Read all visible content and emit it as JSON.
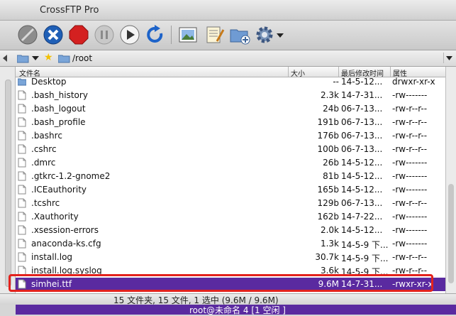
{
  "window": {
    "title": "CrossFTP Pro"
  },
  "toolbar": {
    "icons": [
      "disconnect-icon",
      "connect-x-icon",
      "stop-icon",
      "pause-icon",
      "play-icon",
      "refresh-icon",
      "image-view-icon",
      "notes-edit-icon",
      "new-folder-icon",
      "gear-icon"
    ]
  },
  "pathbar": {
    "path": "/root"
  },
  "columns": {
    "name": "文件名",
    "size": "大小",
    "modified": "最后修改时间",
    "attributes": "属性"
  },
  "files": [
    {
      "name": "Desktop",
      "size": "--",
      "modified": "14-5-12...",
      "perm": "drwxr-xr-x",
      "type": "folder"
    },
    {
      "name": ".bash_history",
      "size": "2.3k",
      "modified": "14-7-31...",
      "perm": "-rw-------",
      "type": "file"
    },
    {
      "name": ".bash_logout",
      "size": "24b",
      "modified": "06-7-13...",
      "perm": "-rw-r--r--",
      "type": "file"
    },
    {
      "name": ".bash_profile",
      "size": "191b",
      "modified": "06-7-13...",
      "perm": "-rw-r--r--",
      "type": "file"
    },
    {
      "name": ".bashrc",
      "size": "176b",
      "modified": "06-7-13...",
      "perm": "-rw-r--r--",
      "type": "file"
    },
    {
      "name": ".cshrc",
      "size": "100b",
      "modified": "06-7-13...",
      "perm": "-rw-r--r--",
      "type": "file"
    },
    {
      "name": ".dmrc",
      "size": "26b",
      "modified": "14-5-12...",
      "perm": "-rw-------",
      "type": "file"
    },
    {
      "name": ".gtkrc-1.2-gnome2",
      "size": "81b",
      "modified": "14-5-12...",
      "perm": "-rw-------",
      "type": "file"
    },
    {
      "name": ".ICEauthority",
      "size": "165b",
      "modified": "14-5-12...",
      "perm": "-rw-------",
      "type": "file"
    },
    {
      "name": ".tcshrc",
      "size": "129b",
      "modified": "06-7-13...",
      "perm": "-rw-r--r--",
      "type": "file"
    },
    {
      "name": ".Xauthority",
      "size": "162b",
      "modified": "14-7-22...",
      "perm": "-rw-------",
      "type": "file"
    },
    {
      "name": ".xsession-errors",
      "size": "2.0k",
      "modified": "14-5-12...",
      "perm": "-rw-------",
      "type": "file"
    },
    {
      "name": "anaconda-ks.cfg",
      "size": "1.3k",
      "modified": "14-5-9 下...",
      "perm": "-rw-------",
      "type": "file"
    },
    {
      "name": "install.log",
      "size": "30.7k",
      "modified": "14-5-9 下...",
      "perm": "-rw-r--r--",
      "type": "file"
    },
    {
      "name": "install.log.syslog",
      "size": "3.6k",
      "modified": "14-5-9 下...",
      "perm": "-rw-r--r--",
      "type": "file"
    },
    {
      "name": "simhei.ttf",
      "size": "9.6M",
      "modified": "14-7-31...",
      "perm": "-rwxr-xr-x",
      "type": "file",
      "selected": true
    }
  ],
  "status": {
    "text": "15 文件夹, 15 文件, 1 选中 (9.6M / 9.6M)"
  },
  "session": {
    "text": "root@未命名 4 [1 空闲 ]"
  },
  "colors": {
    "selection": "#5a2aa0",
    "highlight_border": "#e3221d"
  }
}
